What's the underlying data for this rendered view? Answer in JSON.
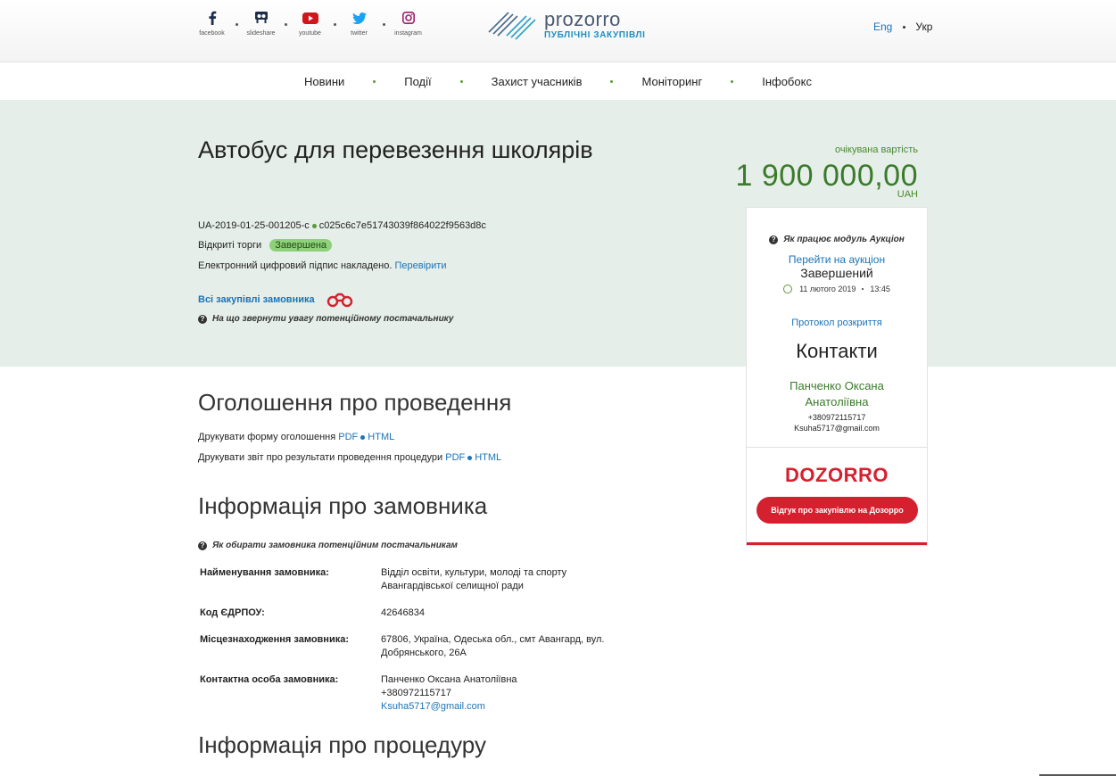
{
  "socials": [
    {
      "icon": "facebook-icon",
      "label": "facebook"
    },
    {
      "icon": "slideshare-icon",
      "label": "slideshare"
    },
    {
      "icon": "youtube-icon",
      "label": "youtube"
    },
    {
      "icon": "twitter-icon",
      "label": "twitter"
    },
    {
      "icon": "instagram-icon",
      "label": "instagram"
    }
  ],
  "logo": {
    "name": "prozorro",
    "subtitle": "ПУБЛІЧНІ ЗАКУПІВЛІ"
  },
  "lang": {
    "eng": "Eng",
    "ukr": "Укр"
  },
  "nav": [
    "Новини",
    "Події",
    "Захист учасників",
    "Моніторинг",
    "Інфобокс"
  ],
  "tender": {
    "title": "Автобус для перевезення школярів",
    "id": "UA-2019-01-25-001205-c",
    "hash": "c025c6c7e51743039f864022f9563d8c",
    "procedure": "Відкриті торги",
    "status": "Завершена",
    "signature_text": "Електронний цифровий підпис накладено.",
    "signature_link": "Перевірити",
    "all_purchases": "Всі закупівлі замовника",
    "hint": "На що звернути увагу потенційному постачальнику",
    "expected_label": "очікувана вартість",
    "price": "1 900 000,00",
    "currency": "UAH"
  },
  "card": {
    "auction_help": "Як працює модуль Аукціон",
    "auction_link": "Перейти на аукціон",
    "auction_status": "Завершений",
    "auction_date": "11 лютого 2019",
    "auction_time": "13:45",
    "protocol": "Протокол розкриття",
    "contacts_title": "Контакти",
    "contact_name_1": "Панченко Оксана",
    "contact_name_2": "Анатоліївна",
    "phone": "+380972115717",
    "email": "Ksuha5717@gmail.com",
    "dozorro_logo": "DOZORRO",
    "dozorro_button": "Відгук про закупівлю на Дозорро"
  },
  "announcement": {
    "title": "Оголошення про проведення",
    "print_form": "Друкувати форму оголошення",
    "print_report": "Друкувати звіт про результати проведення процедури",
    "pdf": "PDF",
    "html": "HTML"
  },
  "customer": {
    "title": "Інформація про замовника",
    "hint": "Як обирати замовника потенційним постачальникам",
    "rows": [
      {
        "label": "Найменування замовника:",
        "value_1": "Відділ освіти, культури, молоді та спорту",
        "value_2": "Авангардівської селищної ради"
      },
      {
        "label": "Код ЄДРПОУ:",
        "value_1": "42646834"
      },
      {
        "label": "Місцезнаходження замовника:",
        "value_1": "67806, Україна, Одеська обл., смт Авангард, вул.",
        "value_2": "Добрянського, 26А"
      },
      {
        "label": "Контактна особа замовника:",
        "value_1": "Панченко Оксана Анатоліївна",
        "value_2": "+380972115717",
        "value_3": "Ksuha5717@gmail.com"
      }
    ]
  },
  "procedure": {
    "title": "Інформація про процедуру"
  },
  "colors": {
    "accent_green": "#3a7a2a",
    "link_blue": "#1a73b7",
    "dozorro_red": "#d5202f",
    "hero_bg": "#e5eee9"
  }
}
